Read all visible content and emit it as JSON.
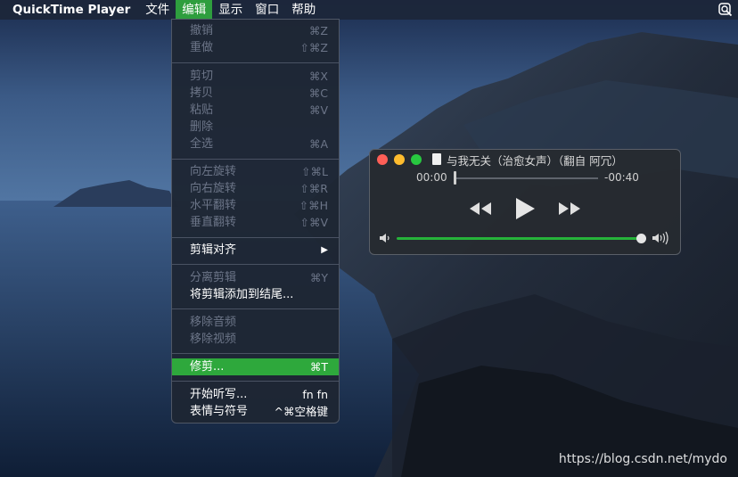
{
  "menubar": {
    "app_name": "QuickTime Player",
    "items": [
      "文件",
      "编辑",
      "显示",
      "窗口",
      "帮助"
    ],
    "active_item": "编辑",
    "accent_color": "#2e9e3e"
  },
  "edit_menu": {
    "items": [
      {
        "label": "撤销",
        "shortcut": "⌘Z",
        "enabled": false
      },
      {
        "label": "重做",
        "shortcut": "⇧⌘Z",
        "enabled": false
      },
      {
        "label": "剪切",
        "shortcut": "⌘X",
        "enabled": false
      },
      {
        "label": "拷贝",
        "shortcut": "⌘C",
        "enabled": false
      },
      {
        "label": "粘贴",
        "shortcut": "⌘V",
        "enabled": false
      },
      {
        "label": "删除",
        "shortcut": "",
        "enabled": false
      },
      {
        "label": "全选",
        "shortcut": "⌘A",
        "enabled": false
      },
      {
        "label": "向左旋转",
        "shortcut": "⇧⌘L",
        "enabled": false
      },
      {
        "label": "向右旋转",
        "shortcut": "⇧⌘R",
        "enabled": false
      },
      {
        "label": "水平翻转",
        "shortcut": "⇧⌘H",
        "enabled": false
      },
      {
        "label": "垂直翻转",
        "shortcut": "⇧⌘V",
        "enabled": false
      },
      {
        "label": "剪辑对齐",
        "shortcut": "▶",
        "enabled": true
      },
      {
        "label": "分离剪辑",
        "shortcut": "⌘Y",
        "enabled": false
      },
      {
        "label": "将剪辑添加到结尾...",
        "shortcut": "",
        "enabled": true
      },
      {
        "label": "移除音频",
        "shortcut": "",
        "enabled": false
      },
      {
        "label": "移除视频",
        "shortcut": "",
        "enabled": false
      },
      {
        "label": "修剪...",
        "shortcut": "⌘T",
        "enabled": true,
        "highlighted": true
      },
      {
        "label": "开始听写...",
        "shortcut": "fn fn",
        "enabled": true
      },
      {
        "label": "表情与符号",
        "shortcut": "^⌘空格键",
        "enabled": true
      }
    ]
  },
  "player": {
    "title": "与我无关（治愈女声）（翻自 阿冗）",
    "elapsed": "00:00",
    "remaining": "-00:40",
    "playback_progress": 0.0,
    "volume_level": 1.0,
    "icons": [
      "rewind-icon",
      "play-icon",
      "fast-forward-icon",
      "volume-low-icon",
      "volume-high-icon"
    ]
  },
  "watermark": "https://blog.csdn.net/mydo"
}
